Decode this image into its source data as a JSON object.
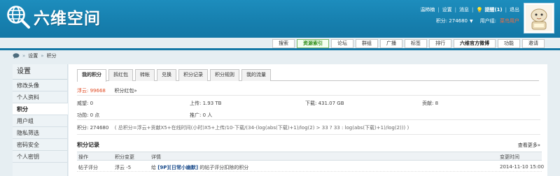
{
  "site": {
    "name": "六维空间"
  },
  "topnav": {
    "username": "温柿楠",
    "settings": "设置",
    "messages": "消息",
    "reminder_label": "提醒(1)",
    "exit": "退出"
  },
  "account": {
    "score_label": "积分: 274680",
    "group_label": "用户组:",
    "group_value": "菜鸟用户"
  },
  "menu": [
    {
      "label": "搜索",
      "active": false
    },
    {
      "label": "资源索引",
      "active": true
    },
    {
      "label": "论坛",
      "active": false
    },
    {
      "label": "群组",
      "active": false
    },
    {
      "label": "广播",
      "active": false
    },
    {
      "label": "标签",
      "active": false
    },
    {
      "label": "排行",
      "active": false
    },
    {
      "label": "六维官方微博",
      "active": false
    },
    {
      "label": "功能",
      "active": false
    },
    {
      "label": "邀请",
      "active": false
    }
  ],
  "breadcrumb": {
    "settings": "设置",
    "points": "积分"
  },
  "sidebar": {
    "title": "设置",
    "items": [
      {
        "label": "修改头像"
      },
      {
        "label": "个人资料"
      },
      {
        "label": "积分"
      },
      {
        "label": "用户组"
      },
      {
        "label": "隐私筛选"
      },
      {
        "label": "密码安全"
      },
      {
        "label": "个人密钥"
      }
    ]
  },
  "tabs": [
    {
      "label": "我的积分"
    },
    {
      "label": "拆红包"
    },
    {
      "label": "转帐"
    },
    {
      "label": "兑换"
    },
    {
      "label": "积分记录"
    },
    {
      "label": "积分规则"
    },
    {
      "label": "我的流量"
    }
  ],
  "stats": {
    "fuyun": "浮云: 99668",
    "redpacket": "积分红包»",
    "weiwang": "威望: 0",
    "upload": "上传: 1.93 TB",
    "download": "下载: 431.07 GB",
    "contribution": "贡献: 8",
    "gongxun": "功勋: 0 点",
    "tuiguang": "推广: 0 人",
    "points_total": "积分: 274680",
    "points_formula": "( 总积分=浮云+贡献X5+在线时间(小时)X5+上传/10-下载/(34-(log(abs(下载)+1)/log(2) > 33 ? 33 : log(abs(下载)+1)/log(2))) )"
  },
  "records": {
    "title": "积分记录",
    "more": "查看更多»",
    "columns": {
      "operation": "操作",
      "change": "积分变更",
      "detail": "详情",
      "time": "变更时间"
    },
    "rows": [
      {
        "operation": "帖子评分",
        "change": "浮云 -5",
        "detail_prefix": "给",
        "detail_link": "[9P][日常小幽默]",
        "detail_suffix": "的帖子评分扣除的积分",
        "time": "2014-11-10 15:00"
      }
    ]
  },
  "colors": {
    "header_bg": "#1782b2",
    "accent_red": "#e04b24",
    "active_menu": "#2a8a13"
  }
}
